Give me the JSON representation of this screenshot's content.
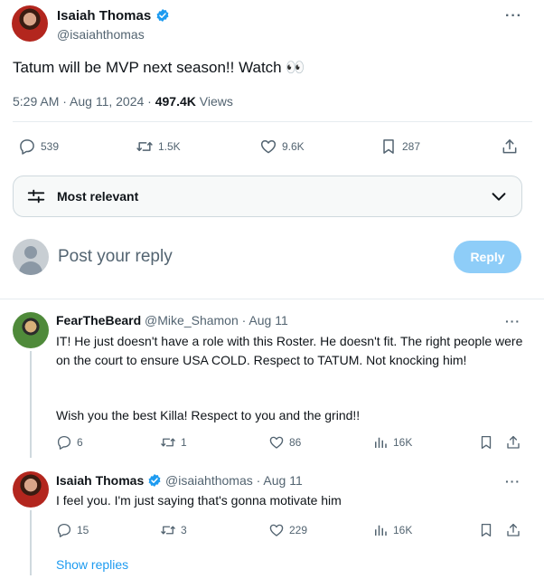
{
  "tweet": {
    "author_name": "Isaiah Thomas",
    "author_handle": "@isaiahthomas",
    "text": "Tatum will be MVP next season!!  Watch 👀",
    "time": "5:29 AM · Aug 11, 2024 · ",
    "views_count": "497.4K",
    "views_label": " Views",
    "more_label": "···",
    "stats": {
      "replies": "539",
      "reposts": "1.5K",
      "likes": "9.6K",
      "bookmarks": "287"
    }
  },
  "filter": {
    "label": "Most relevant"
  },
  "composer": {
    "placeholder": "Post your reply",
    "button_label": "Reply"
  },
  "replies": [
    {
      "author_name": "FearTheBeard",
      "author_handle": "@Mike_Shamon",
      "date": " · Aug 11",
      "paragraph_1": "IT! He just doesn't have a role with this Roster. He doesn't fit. The right people were on the court to ensure USA COLD. Respect to TATUM. Not knocking him!",
      "paragraph_2": "Wish you the best Killa! Respect to you and the grind!!",
      "stats": {
        "replies": "6",
        "reposts": "1",
        "likes": "86",
        "views": "16K"
      }
    },
    {
      "author_name": "Isaiah Thomas",
      "author_handle": "@isaiahthomas",
      "date": " · Aug 11",
      "text": "I feel you. I'm just saying that's gonna motivate him",
      "stats": {
        "replies": "15",
        "reposts": "3",
        "likes": "229",
        "views": "16K"
      },
      "show_replies_label": "Show replies"
    }
  ],
  "colors": {
    "accent": "#1d9bf0",
    "reply_button": "#8ecdf8",
    "secondary_text": "#536471"
  },
  "icons": {
    "verified": "verified-badge-icon",
    "reply": "reply-icon",
    "repost": "repost-icon",
    "like": "heart-icon",
    "bookmark": "bookmark-icon",
    "share": "share-icon",
    "views": "views-icon",
    "filter": "sliders-icon",
    "dropdown": "chevron-down-icon",
    "more": "more-icon"
  }
}
